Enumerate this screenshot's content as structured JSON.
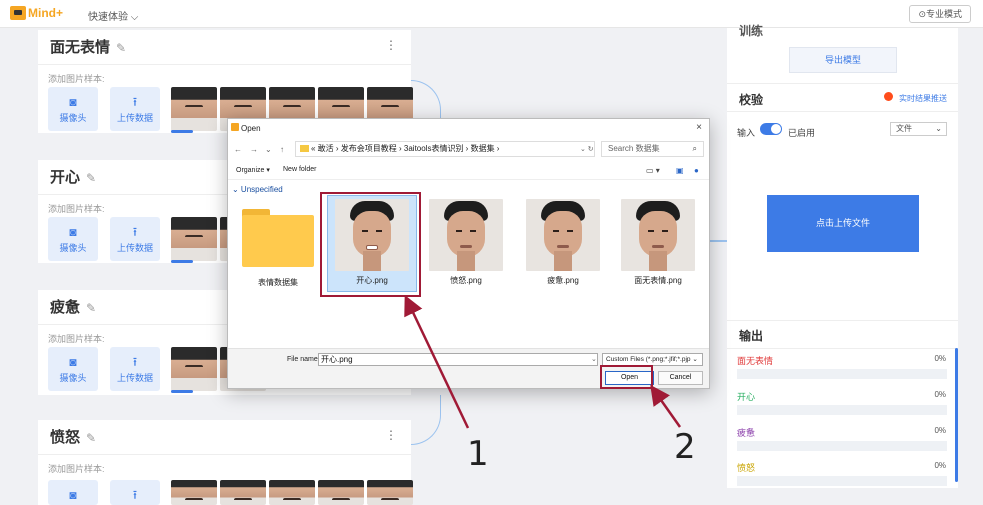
{
  "topbar": {
    "logo_text": "Mind+",
    "quick_label": "快速体验 ⌵",
    "pro_mode_label": "⊙专业模式"
  },
  "classes": [
    {
      "title": "面无表情",
      "add_label": "添加图片样本:",
      "camera_label": "摄像头",
      "upload_label": "上传数据"
    },
    {
      "title": "开心",
      "add_label": "添加图片样本:",
      "camera_label": "摄像头",
      "upload_label": "上传数据"
    },
    {
      "title": "疲惫",
      "add_label": "添加图片样本:",
      "camera_label": "摄像头",
      "upload_label": "上传数据"
    },
    {
      "title": "愤怒",
      "add_label": "添加图片样本:",
      "camera_label": "摄像头",
      "upload_label": "上传数据"
    }
  ],
  "card_menu_glyph": "⋮",
  "right_panel": {
    "train_title": "训练",
    "export_label": "导出模型",
    "verify_title": "校验",
    "live_label": "实时结果推送",
    "input_label": "输入",
    "enabled_label": "已启用",
    "file_select": "文件",
    "upload_file_label": "点击上传文件",
    "output_title": "输出",
    "outputs": [
      {
        "label": "面无表情",
        "pct": "0%",
        "color": "#e03a3a"
      },
      {
        "label": "开心",
        "pct": "0%",
        "color": "#27ae60"
      },
      {
        "label": "疲惫",
        "pct": "0%",
        "color": "#8e44ad"
      },
      {
        "label": "愤怒",
        "pct": "0%",
        "color": "#c9a400"
      }
    ]
  },
  "dialog": {
    "title": "Open",
    "close": "×",
    "nav_back": "←",
    "nav_forward": "→",
    "nav_down": "⌄",
    "nav_up": "↑",
    "address": "« 敢活 › 发布会项目教程 › 3aitools表情识别 › 数据集 ›",
    "refresh": "⌄   ↻",
    "search_placeholder": "Search 数据集",
    "toolbar_organize": "Organize ▾",
    "toolbar_new_folder": "New folder",
    "group_header": "⌄ Unspecified",
    "files": [
      {
        "name": "表情数据集",
        "kind": "folder"
      },
      {
        "name": "开心.png",
        "kind": "image"
      },
      {
        "name": "愤怒.png",
        "kind": "image"
      },
      {
        "name": "疲惫.png",
        "kind": "image"
      },
      {
        "name": "面无表情.png",
        "kind": "image"
      }
    ],
    "file_name_label": "File name:",
    "file_name_value": "开心.png",
    "filter_value": "Custom Files (*.png;*.jfif;*.pjp ⌄",
    "open_label": "Open",
    "cancel_label": "Cancel"
  },
  "annotations": {
    "one": "1",
    "two": "2"
  },
  "colors": {
    "accent": "#3d7be6",
    "annotation": "#a01a36"
  }
}
